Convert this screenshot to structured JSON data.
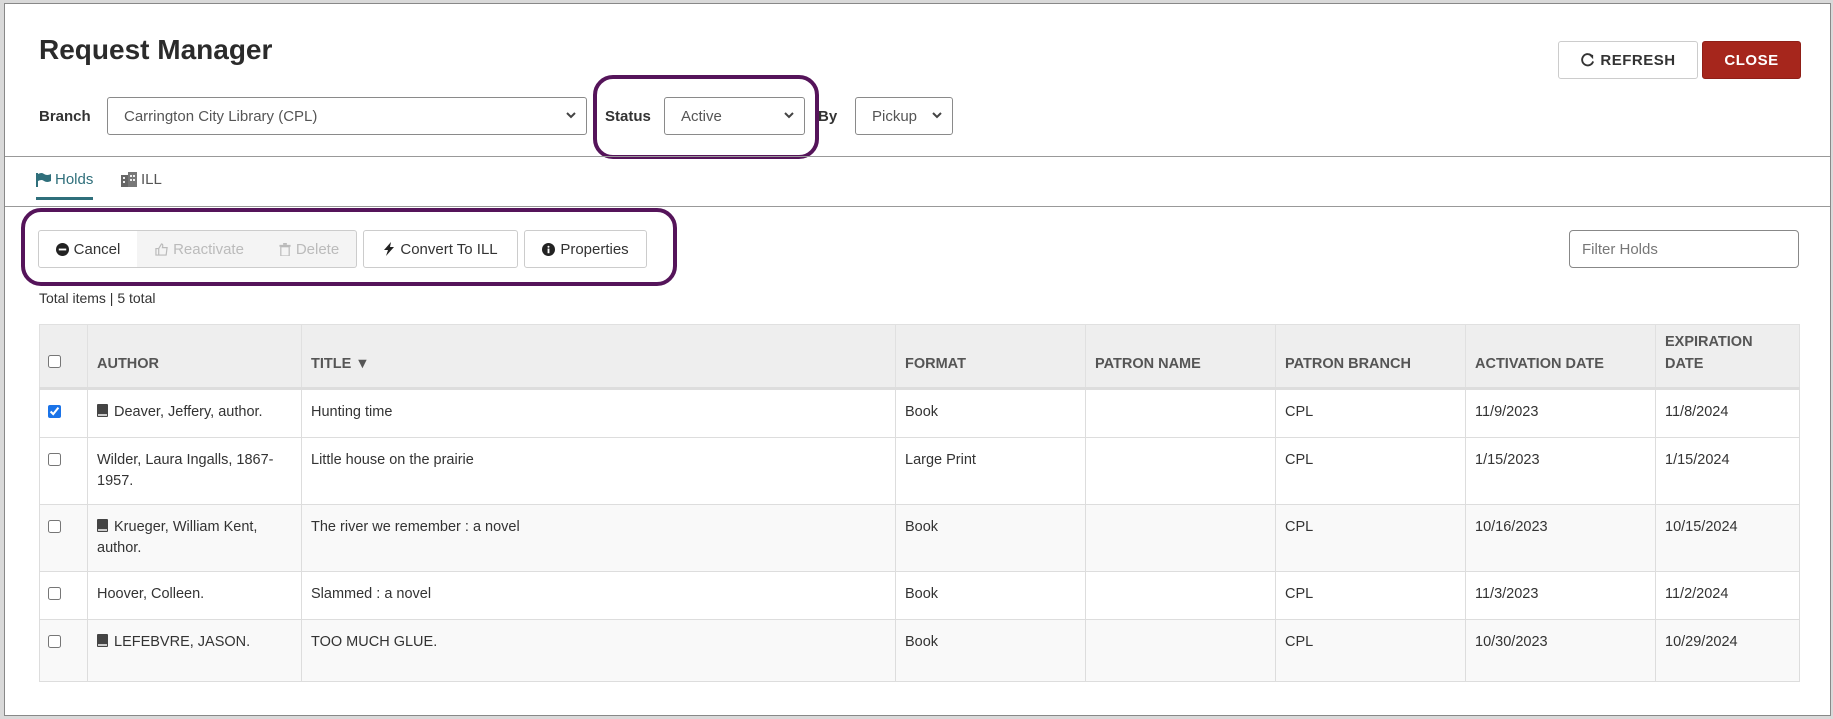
{
  "header": {
    "title": "Request Manager",
    "refresh_label": "REFRESH",
    "close_label": "CLOSE"
  },
  "filters": {
    "branch_label": "Branch",
    "branch_value": "Carrington City Library (CPL)",
    "status_label": "Status",
    "status_value": "Active",
    "by_label": "By",
    "by_value": "Pickup"
  },
  "tabs": [
    {
      "label": "Holds",
      "icon": "flag-icon",
      "active": true
    },
    {
      "label": "ILL",
      "icon": "building-icon",
      "active": false
    }
  ],
  "toolbar": {
    "cancel_label": "Cancel",
    "reactivate_label": "Reactivate",
    "delete_label": "Delete",
    "convert_label": "Convert To ILL",
    "properties_label": "Properties",
    "filter_placeholder": "Filter Holds"
  },
  "summary": {
    "total_text": "Total items | 5 total"
  },
  "table": {
    "columns": [
      "AUTHOR",
      "TITLE ▼",
      "FORMAT",
      "PATRON NAME",
      "PATRON BRANCH",
      "ACTIVATION DATE",
      "EXPIRATION DATE"
    ],
    "rows": [
      {
        "checked": true,
        "book_icon": true,
        "author": "Deaver, Jeffery, author.",
        "title": "Hunting time",
        "format": "Book",
        "patron_name": "",
        "patron_branch": "CPL",
        "activation": "11/9/2023",
        "expiration": "11/8/2024"
      },
      {
        "checked": false,
        "book_icon": false,
        "author": "Wilder, Laura Ingalls, 1867-1957.",
        "title": "Little house on the prairie",
        "format": "Large Print",
        "patron_name": "",
        "patron_branch": "CPL",
        "activation": "1/15/2023",
        "expiration": "1/15/2024"
      },
      {
        "checked": false,
        "book_icon": true,
        "author": "Krueger, William Kent, author.",
        "title": "The river we remember : a novel",
        "format": "Book",
        "patron_name": "",
        "patron_branch": "CPL",
        "activation": "10/16/2023",
        "expiration": "10/15/2024"
      },
      {
        "checked": false,
        "book_icon": false,
        "author": "Hoover, Colleen.",
        "title": "Slammed : a novel",
        "format": "Book",
        "patron_name": "",
        "patron_branch": "CPL",
        "activation": "11/3/2023",
        "expiration": "11/2/2024"
      },
      {
        "checked": false,
        "book_icon": true,
        "author": "LEFEBVRE, JASON.",
        "title": "TOO MUCH GLUE.",
        "format": "Book",
        "patron_name": "",
        "patron_branch": "CPL",
        "activation": "10/30/2023",
        "expiration": "10/29/2024"
      }
    ]
  },
  "colors": {
    "accent": "#2f6f7b",
    "close_button": "#a6261c",
    "highlight": "#55145a"
  }
}
